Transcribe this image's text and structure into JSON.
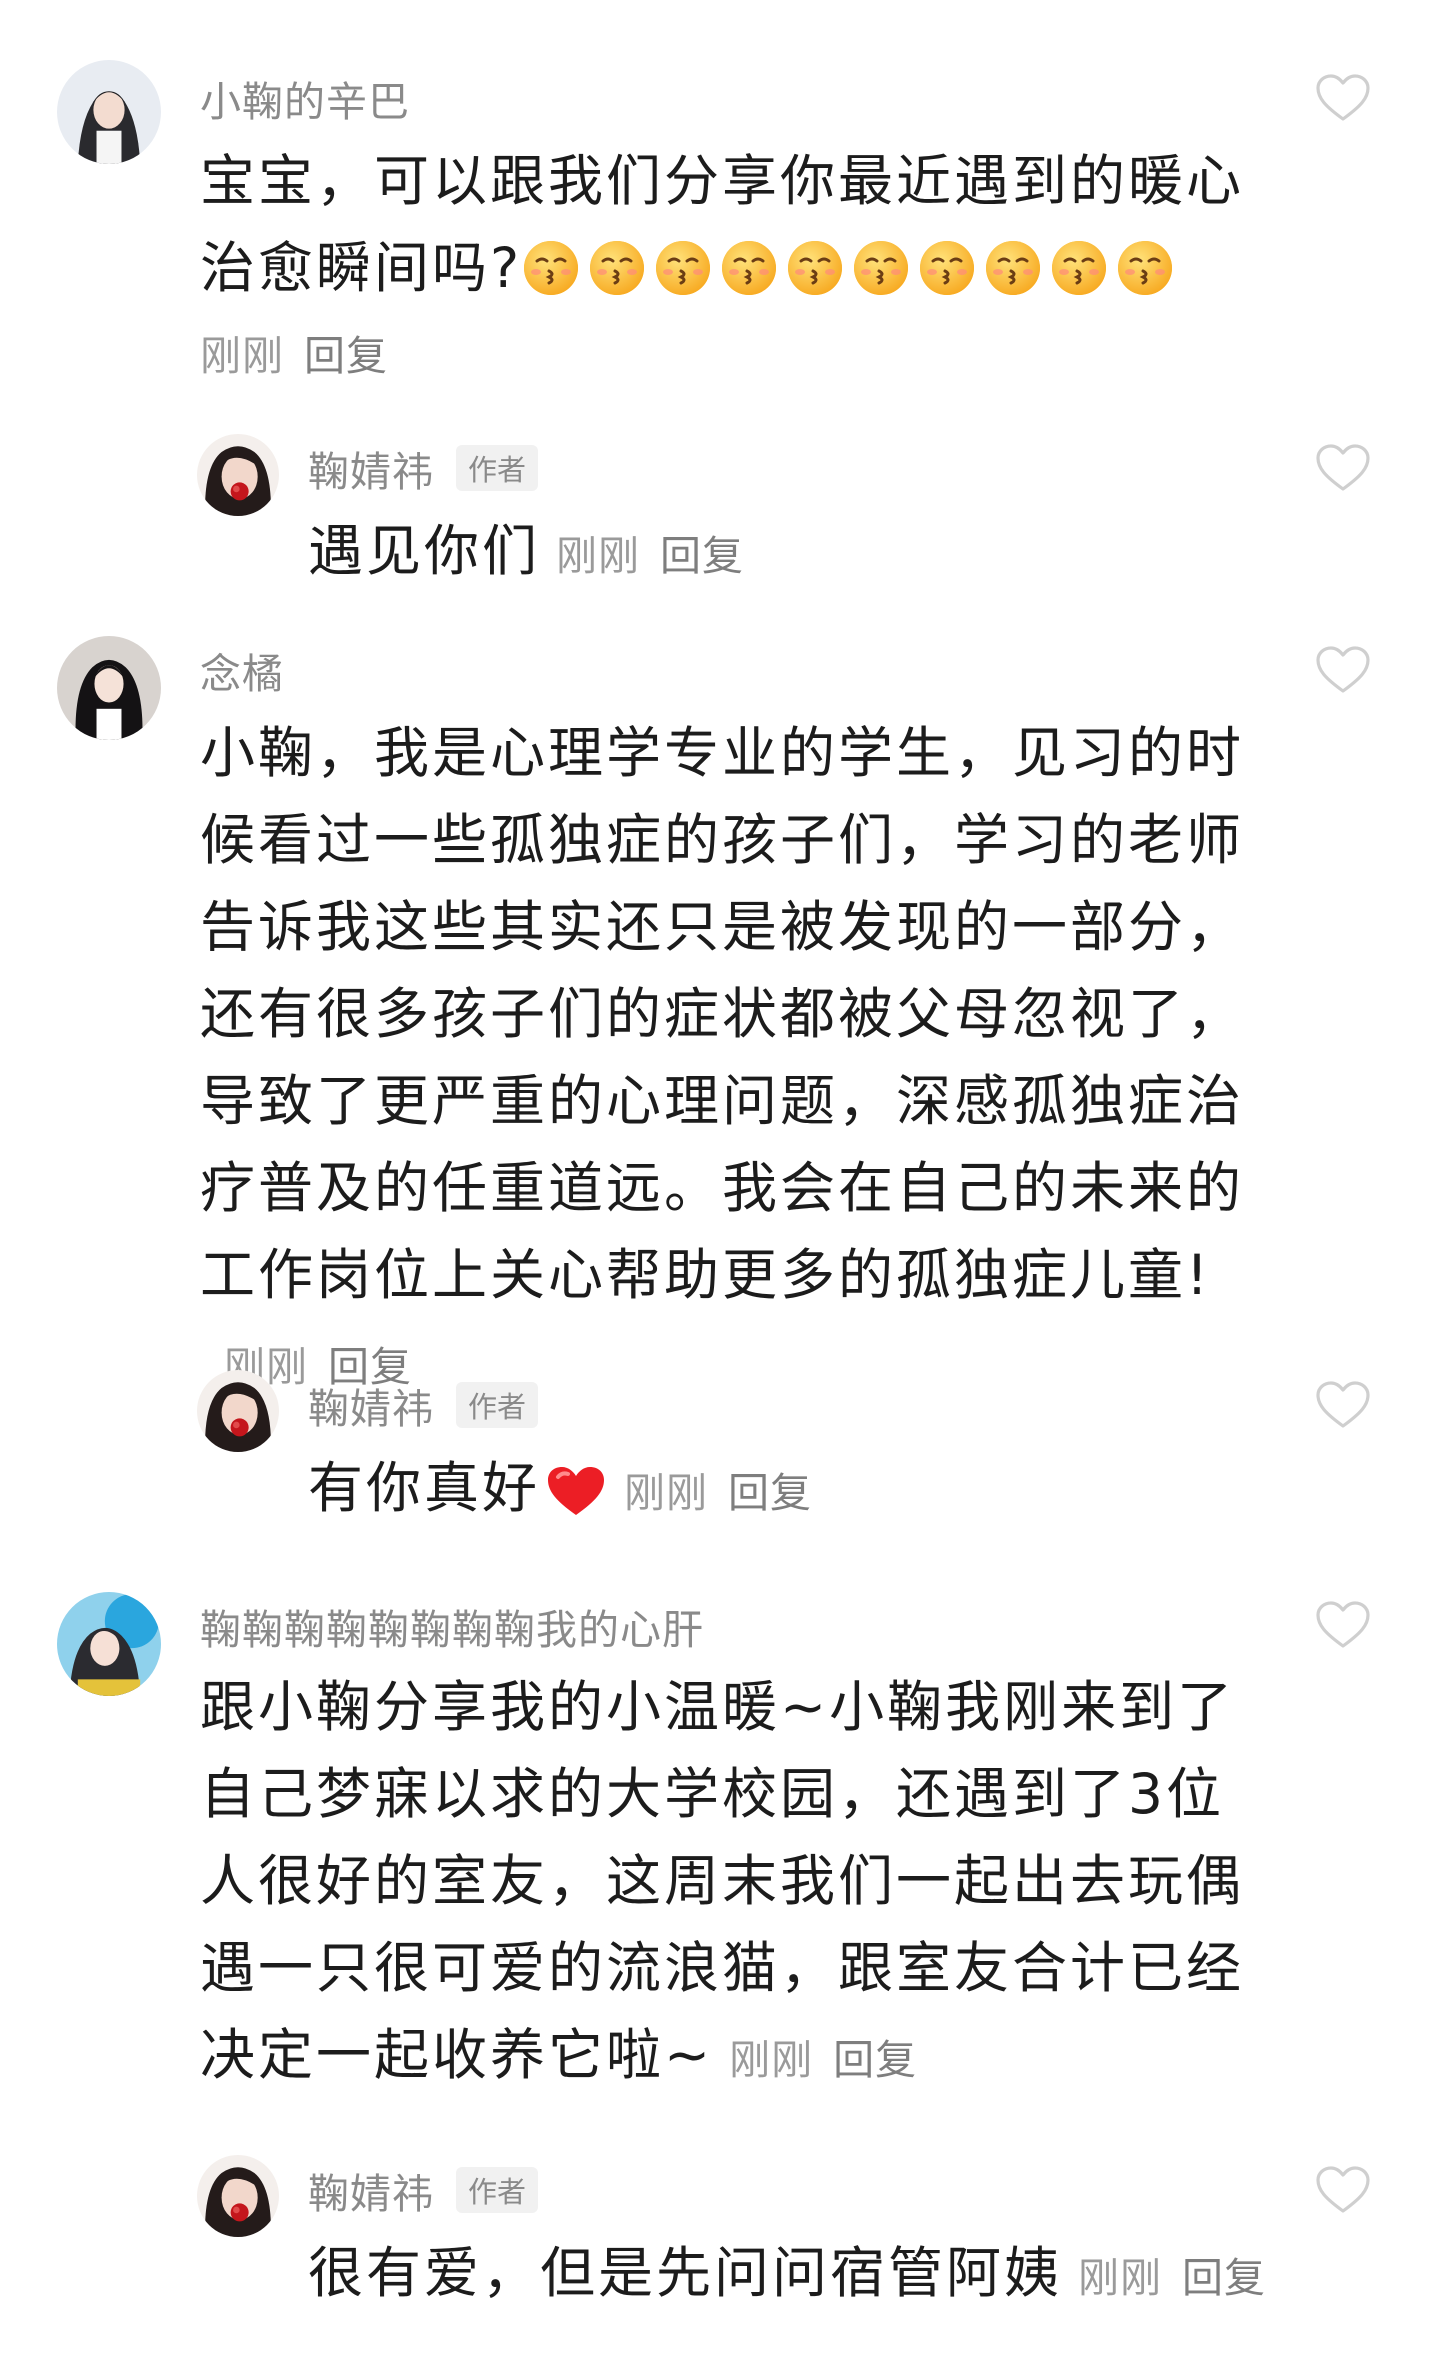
{
  "comments": [
    {
      "name": "小鞠的辛巴",
      "text": "宝宝，可以跟我们分享你最近遇到的暖心治愈瞬间吗?",
      "emoji": "kissing-face-emoji",
      "emoji_count": 10,
      "time": "刚刚",
      "reply": "回复"
    },
    {
      "name": "鞠婧祎",
      "badge": "作者",
      "text": "遇见你们",
      "time": "刚刚",
      "reply": "回复"
    },
    {
      "name": "念橘",
      "text": "小鞠，我是心理学专业的学生，见习的时候看过一些孤独症的孩子们，学习的老师告诉我这些其实还只是被发现的一部分，还有很多孩子们的症状都被父母忽视了，导致了更严重的心理问题，深感孤独症治疗普及的任重道远。我会在自己的未来的工作岗位上关心帮助更多的孤独症儿童!",
      "time": "刚刚",
      "reply": "回复"
    },
    {
      "name": "鞠婧祎",
      "badge": "作者",
      "text": "有你真好",
      "emoji": "red-heart-emoji",
      "time": "刚刚",
      "reply": "回复"
    },
    {
      "name": "鞠鞠鞠鞠鞠鞠鞠鞠我的心肝",
      "text": "跟小鞠分享我的小温暖~小鞠我刚来到了自己梦寐以求的大学校园，还遇到了3位人很好的室友，这周末我们一起出去玩偶遇一只很可爱的流浪猫，跟室友合计已经决定一起收养它啦~",
      "time": "刚刚",
      "reply": "回复"
    },
    {
      "name": "鞠婧祎",
      "badge": "作者",
      "text": "很有爱，但是先问问宿管阿姨",
      "time": "刚刚",
      "reply": "回复"
    }
  ],
  "icons": {
    "like": "heart-outline-icon",
    "heart_color": "#d6d6d6",
    "accent_red": "#e8262a"
  }
}
